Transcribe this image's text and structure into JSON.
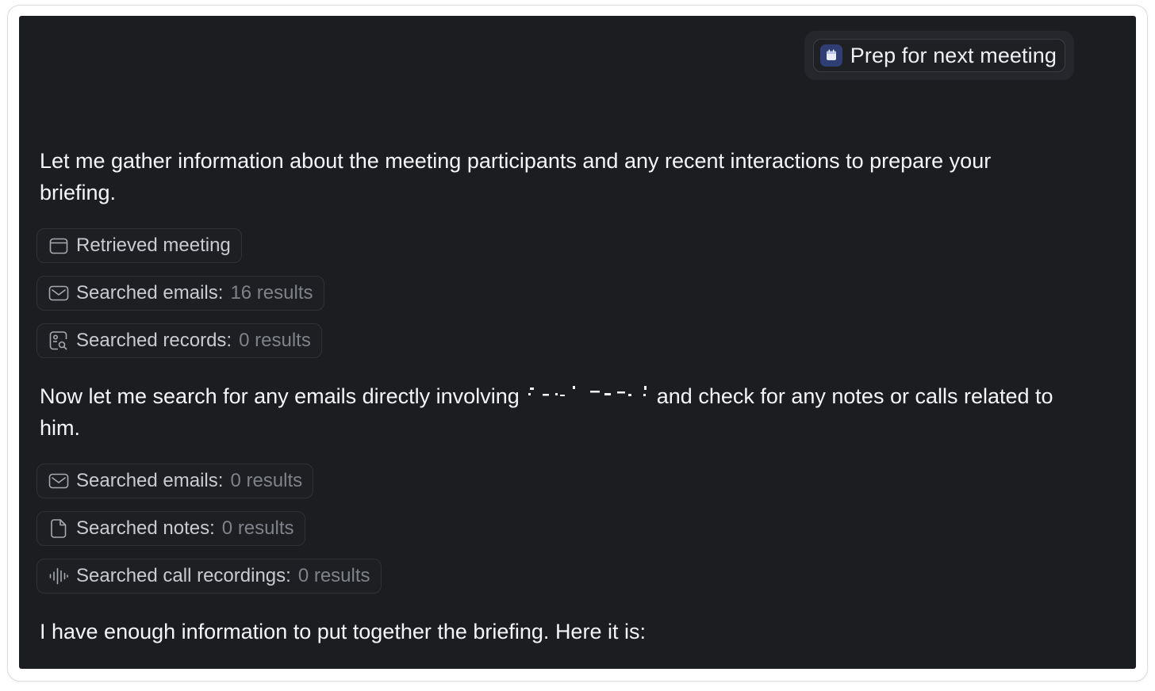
{
  "user_message": {
    "label": "Prep for next meeting",
    "icon": "calendar-icon",
    "accent": "#2f3f74"
  },
  "messages": [
    {
      "text": "Let me gather information about the meeting participants and any recent interactions to prepare your briefing."
    },
    {
      "text_before": "Now let me search for any emails directly involving",
      "text_after": "and check for any notes or calls related to him."
    },
    {
      "text": "I have enough information to put together the briefing. Here it is:"
    }
  ],
  "tool_calls_group_1": [
    {
      "icon": "calendar-icon",
      "label": "Retrieved meeting",
      "count": ""
    },
    {
      "icon": "mail-icon",
      "label": "Searched emails:",
      "count": "16 results"
    },
    {
      "icon": "record-search-icon",
      "label": "Searched records:",
      "count": "0 results"
    }
  ],
  "tool_calls_group_2": [
    {
      "icon": "mail-icon",
      "label": "Searched emails:",
      "count": "0 results"
    },
    {
      "icon": "note-icon",
      "label": "Searched notes:",
      "count": "0 results"
    },
    {
      "icon": "waveform-icon",
      "label": "Searched call recordings:",
      "count": "0 results"
    }
  ],
  "colors": {
    "panel_bg": "#1c1d21",
    "text": "#f4f5f7",
    "muted": "#7f8289"
  }
}
